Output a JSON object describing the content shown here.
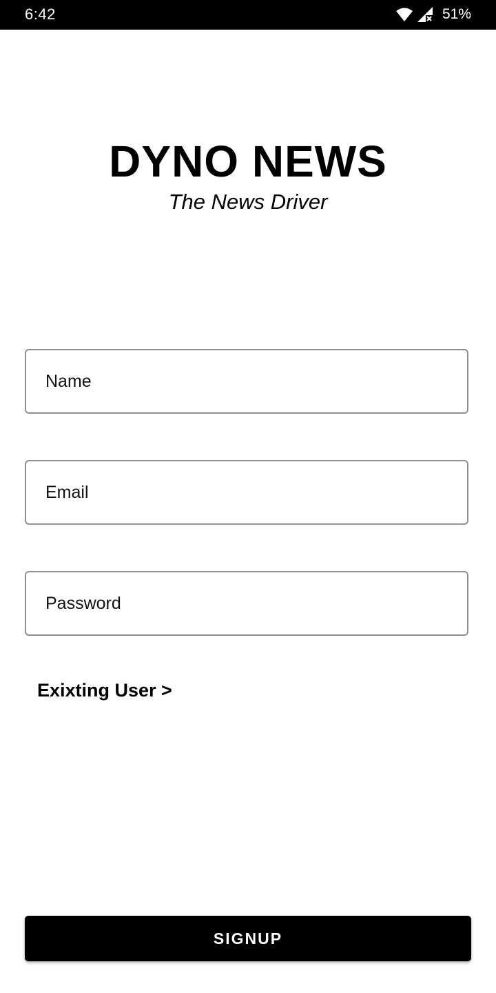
{
  "status_bar": {
    "time": "6:42",
    "battery": "51%",
    "icons": [
      "wifi-icon",
      "signal-icon"
    ]
  },
  "brand": {
    "title": "DYNO NEWS",
    "tagline": "The News Driver"
  },
  "form": {
    "name_placeholder": "Name",
    "email_placeholder": "Email",
    "password_placeholder": "Password",
    "existing_user_label": "Exixting User >",
    "signup_label": "SIGNUP"
  },
  "colors": {
    "background": "#ffffff",
    "status_bar": "#000000",
    "button": "#000000",
    "field_border": "#8f8f8f"
  }
}
